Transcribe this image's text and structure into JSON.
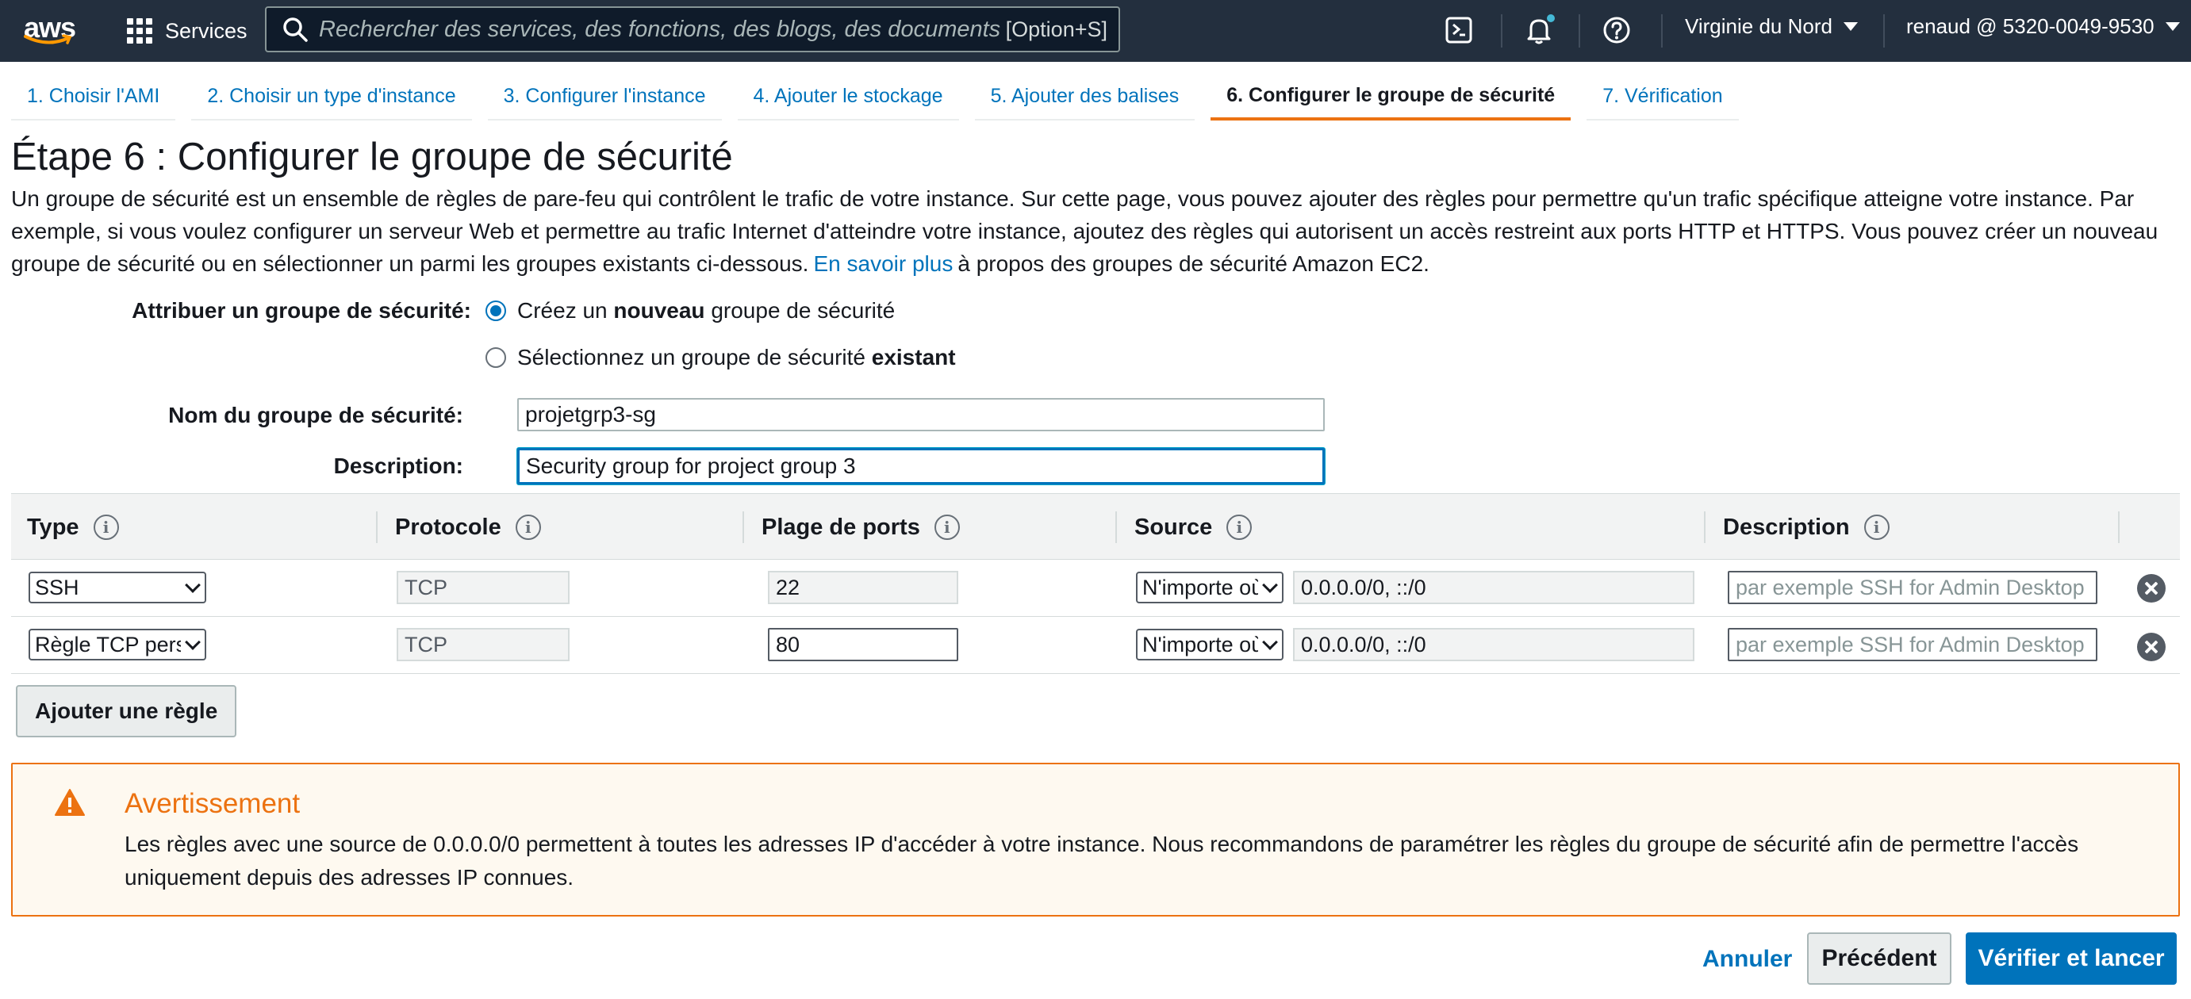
{
  "topnav": {
    "logo_text": "aws",
    "services_label": "Services",
    "search_placeholder": "Rechercher des services, des fonctions, des blogs, des documents et plus",
    "search_shortcut": "[Option+S]",
    "region": "Virginie du Nord",
    "account": "renaud @ 5320-0049-9530",
    "icons": [
      "grid-icon",
      "search-icon",
      "cloudshell-icon",
      "bell-icon",
      "help-icon"
    ]
  },
  "wizard_tabs": [
    {
      "label": "1. Choisir l'AMI",
      "active": false
    },
    {
      "label": "2. Choisir un type d'instance",
      "active": false
    },
    {
      "label": "3. Configurer l'instance",
      "active": false
    },
    {
      "label": "4. Ajouter le stockage",
      "active": false
    },
    {
      "label": "5. Ajouter des balises",
      "active": false
    },
    {
      "label": "6. Configurer le groupe de sécurité",
      "active": true
    },
    {
      "label": "7. Vérification",
      "active": false
    }
  ],
  "page": {
    "title": "Étape 6 : Configurer le groupe de sécurité",
    "intro": "Un groupe de sécurité est un ensemble de règles de pare-feu qui contrôlent le trafic de votre instance. Sur cette page, vous pouvez ajouter des règles pour permettre qu'un trafic spécifique atteigne votre instance. Par exemple, si vous voulez configurer un serveur Web et permettre au trafic Internet d'atteindre votre instance, ajoutez des règles qui autorisent un accès restreint aux ports HTTP et HTTPS. Vous pouvez créer un nouveau groupe de sécurité ou en sélectionner un parmi les groupes existants ci-dessous.",
    "learn_more": "En savoir plus",
    "intro_suffix": "à propos des groupes de sécurité Amazon EC2."
  },
  "assign": {
    "label": "Attribuer un groupe de sécurité:",
    "option_new_pre": "Créez un",
    "option_new_bold": "nouveau",
    "option_new_post": "groupe de sécurité",
    "option_existing_pre": "Sélectionnez un groupe de sécurité",
    "option_existing_bold": "existant",
    "selected": "new"
  },
  "group_name": {
    "label": "Nom du groupe de sécurité:",
    "value": "projetgrp3-sg"
  },
  "group_description": {
    "label": "Description:",
    "value": "Security group for project group 3"
  },
  "rules_table": {
    "headers": [
      "Type",
      "Protocole",
      "Plage de ports",
      "Source",
      "Description"
    ],
    "rows": [
      {
        "type": "SSH",
        "protocol": "TCP",
        "port_range": "22",
        "source_type": "N'importe où",
        "source": "0.0.0.0/0, ::/0",
        "description_placeholder": "par exemple SSH for Admin Desktop"
      },
      {
        "type": "Règle TCP personnalisée",
        "protocol": "TCP",
        "port_range": "80",
        "source_type": "N'importe où",
        "source": "0.0.0.0/0, ::/0",
        "description_placeholder": "par exemple SSH for Admin Desktop"
      }
    ],
    "add_rule_label": "Ajouter une règle"
  },
  "warning": {
    "title": "Avertissement",
    "text": "Les règles avec une source de 0.0.0.0/0 permettent à toutes les adresses IP d'accéder à votre instance. Nous recommandons de paramétrer les règles du groupe de sécurité afin de permettre l'accès uniquement depuis des adresses IP connues."
  },
  "footer": {
    "cancel": "Annuler",
    "previous": "Précédent",
    "primary": "Vérifier et lancer"
  },
  "colors": {
    "nav_bg": "#232f3e",
    "link": "#0073bb",
    "accent": "#ec7211",
    "primary_button": "#0073bb",
    "warning_bg": "#fef9f0"
  }
}
